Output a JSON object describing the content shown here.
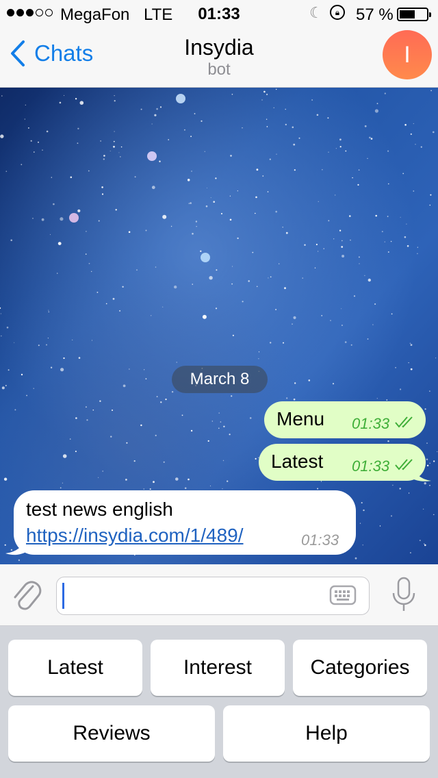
{
  "status_bar": {
    "carrier": "MegaFon",
    "network": "LTE",
    "time": "01:33",
    "battery_percent": "57 %",
    "signal_bars_filled": 3,
    "signal_bars_total": 5,
    "battery_level": 0.57
  },
  "nav": {
    "back_label": "Chats",
    "title": "Insydia",
    "subtitle": "bot",
    "avatar_letter": "I"
  },
  "chat": {
    "date_separator": "March 8",
    "messages": [
      {
        "direction": "out",
        "text": "Menu",
        "time": "01:33",
        "status": "read"
      },
      {
        "direction": "out",
        "text": "Latest",
        "time": "01:33",
        "status": "read"
      },
      {
        "direction": "in",
        "text": "test news english",
        "link": "https://insydia.com/1/489/",
        "time": "01:33"
      }
    ]
  },
  "input": {
    "placeholder": "",
    "value": ""
  },
  "keyboard": {
    "row1": [
      "Latest",
      "Interest",
      "Categories"
    ],
    "row2": [
      "Reviews",
      "Help"
    ]
  },
  "colors": {
    "accent": "#127ee8",
    "outgoing_bubble": "#e1fec6",
    "read_check": "#3fae38",
    "avatar": "#ff7a50"
  }
}
